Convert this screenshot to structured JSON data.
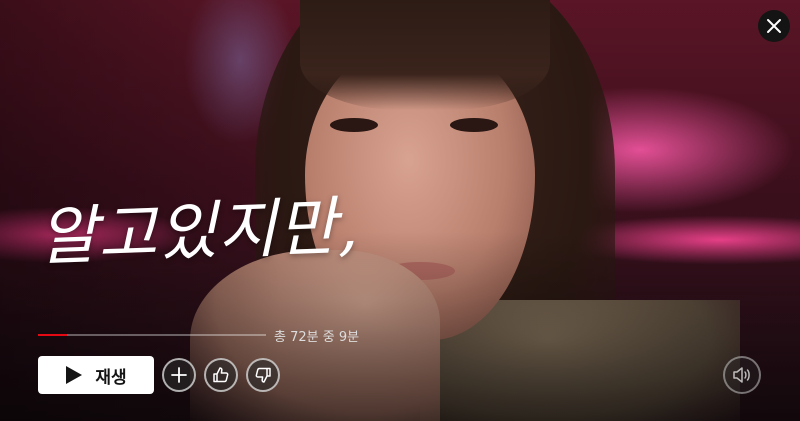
{
  "title": {
    "logo_text": "알고있지만,"
  },
  "playback": {
    "progress_fraction": 0.125,
    "progress_text": "총 72분 중 9분",
    "progress_color": "#e50914"
  },
  "controls": {
    "play_label": "재생",
    "play_icon": "play-icon",
    "add_icon": "plus-icon",
    "like_icon": "thumbs-up-icon",
    "dislike_icon": "thumbs-down-icon",
    "volume_icon": "volume-icon",
    "close_icon": "close-icon"
  }
}
